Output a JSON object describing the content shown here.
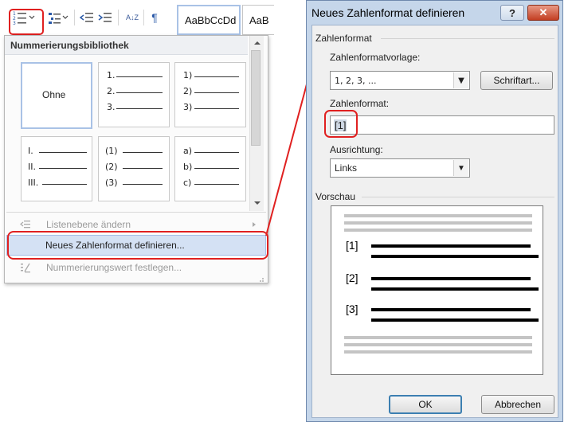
{
  "ribbon": {
    "style_preview_1": "AaBbCcDd",
    "style_preview_2": "AaB",
    "sort_glyph": "A↓Z",
    "pilcrow": "¶"
  },
  "menu": {
    "title": "Nummerierungsbibliothek",
    "tiles": {
      "none": "Ohne",
      "arabic": [
        "1.",
        "2.",
        "3."
      ],
      "paren": [
        "1)",
        "2)",
        "3)"
      ],
      "roman": [
        "I.",
        "II.",
        "III."
      ],
      "paren_num": [
        "(1)",
        "(2)",
        "(3)"
      ],
      "alpha": [
        "a)",
        "b)",
        "c)"
      ]
    },
    "items": {
      "change_level": "Listenebene ändern",
      "define_new": "Neues Zahlenformat definieren...",
      "set_value": "Nummerierungswert festlegen..."
    }
  },
  "dialog": {
    "title": "Neues Zahlenformat definieren",
    "help": "?",
    "close": "✕",
    "group_format": "Zahlenformat",
    "style_label": "Zahlenformatvorlage:",
    "style_value": "1, 2, 3, ...",
    "font_button": "Schriftart...",
    "format_label": "Zahlenformat:",
    "format_value": "[1]",
    "alignment_label": "Ausrichtung:",
    "alignment_value": "Links",
    "group_preview": "Vorschau",
    "preview_numbers": [
      "[1]",
      "[2]",
      "[3]"
    ],
    "ok": "OK",
    "cancel": "Abbrechen"
  },
  "colors": {
    "highlight_red": "#e02020",
    "menu_selected": "#d4e1f4",
    "dialog_frame": "#c5d6ea"
  }
}
